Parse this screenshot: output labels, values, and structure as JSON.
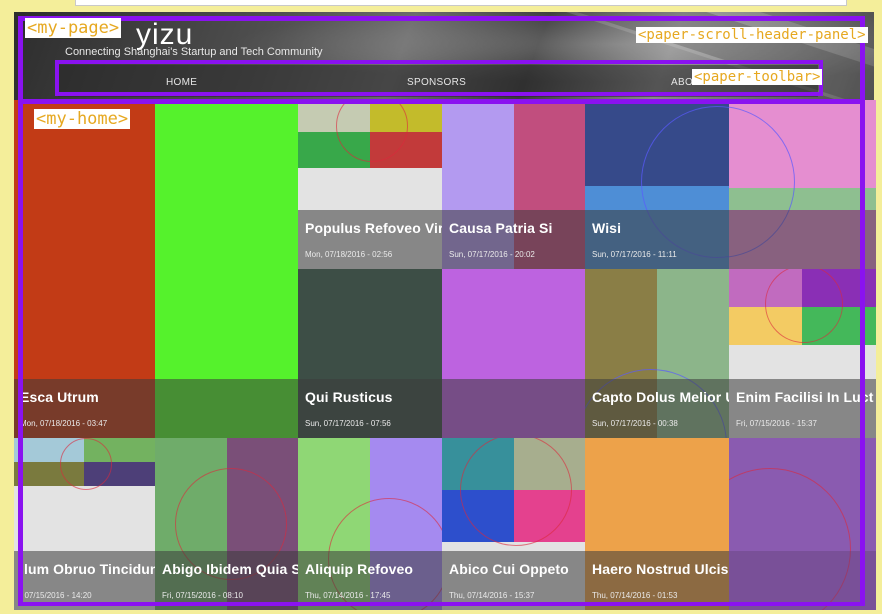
{
  "site": {
    "brand": "yizu",
    "tagline": "Connecting Shanghai's Startup and Tech Community"
  },
  "nav": {
    "items": [
      "HOME",
      "SPONSORS",
      "ABO"
    ]
  },
  "annotations": {
    "page": "<my-page>",
    "header_panel": "<paper-scroll-header-panel>",
    "toolbar": "<paper-toolbar>",
    "home": "<my-home>"
  },
  "posts": [
    {
      "title": "Populus Refoveo Virtu",
      "date": "Mon, 07/18/2016 - 02:56"
    },
    {
      "title": "Causa Patria Si",
      "date": "Sun, 07/17/2016 - 20:02"
    },
    {
      "title": "Wisi",
      "date": "Sun, 07/17/2016 - 11:11"
    },
    {
      "title": "Esca Utrum",
      "date": "Mon, 07/18/2016 - 03:47"
    },
    {
      "title": "Qui Rusticus",
      "date": "Sun, 07/17/2016 - 07:56"
    },
    {
      "title": "Capto Dolus Melior Us",
      "date": "Sun, 07/17/2016 - 00:38"
    },
    {
      "title": "Enim Facilisi In Luct",
      "date": "Fri, 07/15/2016 - 15:37"
    },
    {
      "title": "llum Obruo Tincidunt",
      "date": ", 07/15/2016 - 14:20"
    },
    {
      "title": "Abigo Ibidem Quia Sa",
      "date": "Fri, 07/15/2016 - 08:10"
    },
    {
      "title": "Aliquip Refoveo",
      "date": "Thu, 07/14/2016 - 17:45"
    },
    {
      "title": "Abico Cui Oppeto",
      "date": "Thu, 07/14/2016 - 15:37"
    },
    {
      "title": "Haero Nostrud Ulciscor Ymo",
      "date": "Thu, 07/14/2016 - 01:53"
    }
  ],
  "colors": {
    "annotation_border": "#8a12f0",
    "annotation_text": "#e6a820",
    "background": "#f4ee9a"
  }
}
